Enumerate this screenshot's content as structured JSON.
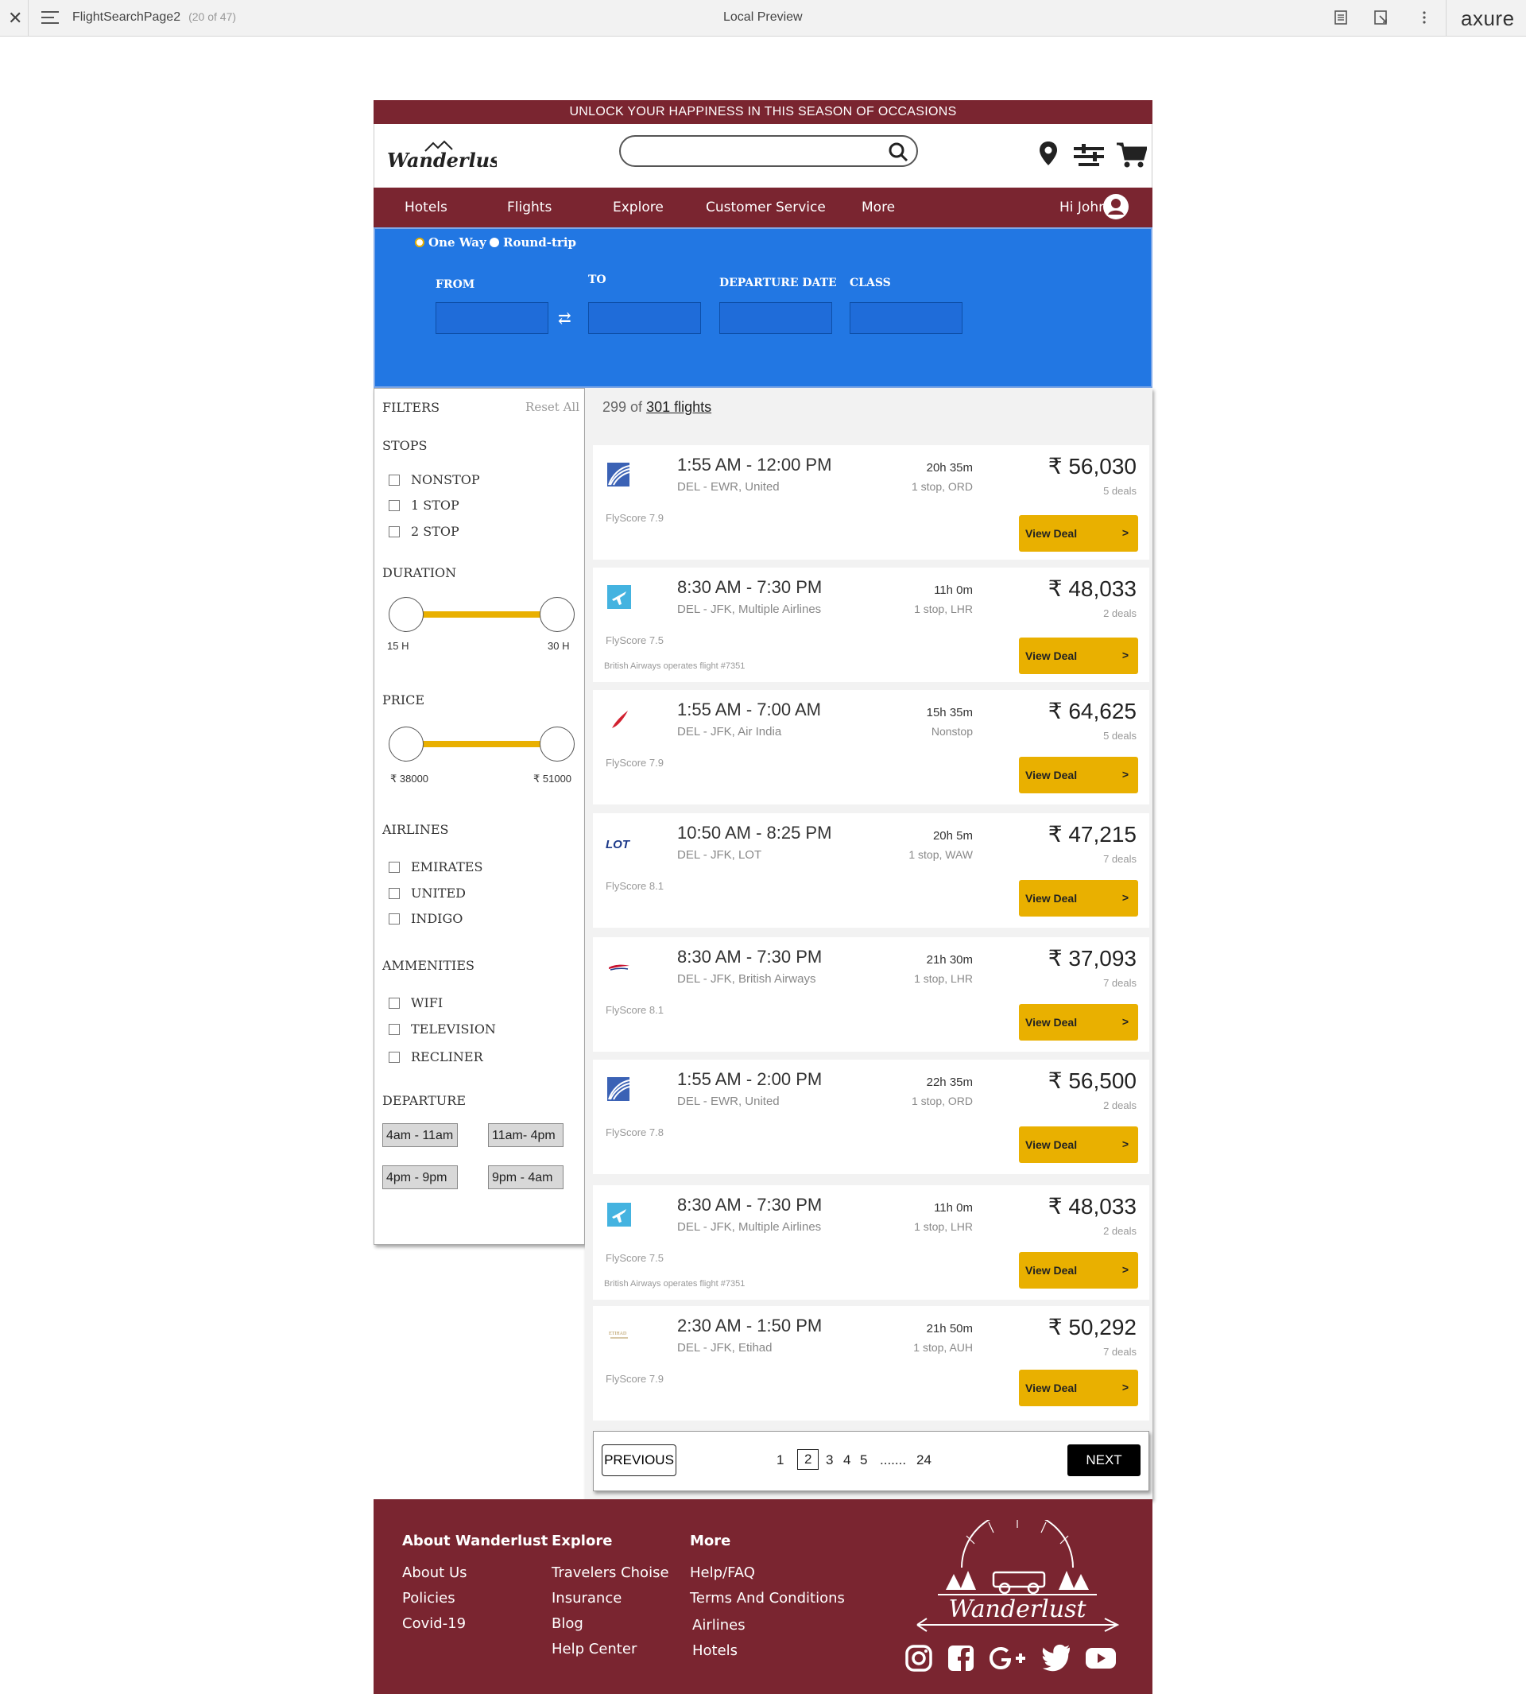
{
  "viewer": {
    "page_title": "FlightSearchPage2",
    "page_count": "(20 of 47)",
    "center_title": "Local Preview",
    "brand": "axure"
  },
  "promo": "UNLOCK YOUR HAPPINESS IN THIS SEASON OF OCCASIONS",
  "header": {
    "logo": "Wanderlust",
    "search_value": ""
  },
  "nav": {
    "hotels": "Hotels",
    "flights": "Flights",
    "explore": "Explore",
    "customer_service": "Customer Service",
    "more": "More",
    "greeting": "Hi John"
  },
  "form": {
    "one_way": "One Way",
    "round_trip": "Round-trip",
    "from": "FROM",
    "to": "TO",
    "departure_date": "DEPARTURE DATE",
    "class": "CLASS"
  },
  "filters": {
    "title": "FILTERS",
    "reset": "Reset All",
    "stops_title": "STOPS",
    "stops": [
      "NONSTOP",
      "1 STOP",
      "2 STOP"
    ],
    "duration_title": "DURATION",
    "duration_min": "15 H",
    "duration_max": "30 H",
    "price_title": "PRICE",
    "price_min": "₹ 38000",
    "price_max": "₹ 51000",
    "airlines_title": "AIRLINES",
    "airlines": [
      "EMIRATES",
      "UNITED",
      "INDIGO"
    ],
    "amenities_title": "AMMENITIES",
    "amenities": [
      "WIFI",
      "TELEVISION",
      "RECLINER"
    ],
    "departure_title": "DEPARTURE",
    "departure": [
      "4am - 11am",
      "11am- 4pm",
      "4pm - 9pm",
      "9pm - 4am"
    ]
  },
  "results": {
    "count_prefix": "299 of",
    "count_link": "301 flights",
    "view_deal": "View Deal",
    "arrow": ">",
    "flights": [
      {
        "time": "1:55 AM - 12:00 PM",
        "route": "DEL - EWR, United",
        "duration": "20h 35m",
        "stops": "1 stop, ORD",
        "price": "₹ 56,030",
        "deals": "5 deals",
        "flyscore": "FlyScore 7.9",
        "note": "",
        "airline_icon": "united-icon"
      },
      {
        "time": "8:30 AM - 7:30 PM",
        "route": "DEL - JFK, Multiple Airlines",
        "duration": "11h 0m",
        "stops": "1 stop, LHR",
        "price": "₹ 48,033",
        "deals": "2 deals",
        "flyscore": "FlyScore 7.5",
        "note": "British Airways operates flight #7351",
        "airline_icon": "multiple-airlines-icon"
      },
      {
        "time": "1:55 AM - 7:00 AM",
        "route": "DEL - JFK, Air India",
        "duration": "15h 35m",
        "stops": "Nonstop",
        "price": "₹ 64,625",
        "deals": "5 deals",
        "flyscore": "FlyScore 7.9",
        "note": "",
        "airline_icon": "air-india-icon"
      },
      {
        "time": "10:50 AM - 8:25 PM",
        "route": "DEL - JFK, LOT",
        "duration": "20h 5m",
        "stops": "1 stop, WAW",
        "price": "₹ 47,215",
        "deals": "7 deals",
        "flyscore": "FlyScore 8.1",
        "note": "",
        "airline_icon": "lot-icon"
      },
      {
        "time": "8:30 AM - 7:30 PM",
        "route": "DEL - JFK, British Airways",
        "duration": "21h 30m",
        "stops": "1 stop, LHR",
        "price": "₹ 37,093",
        "deals": "7 deals",
        "flyscore": "FlyScore 8.1",
        "note": "",
        "airline_icon": "british-airways-icon"
      },
      {
        "time": "1:55 AM - 2:00 PM",
        "route": "DEL - EWR, United",
        "duration": "22h 35m",
        "stops": "1 stop, ORD",
        "price": "₹ 56,500",
        "deals": "2 deals",
        "flyscore": "FlyScore 7.8",
        "note": "",
        "airline_icon": "united-icon"
      },
      {
        "time": "8:30 AM - 7:30 PM",
        "route": "DEL - JFK, Multiple Airlines",
        "duration": "11h 0m",
        "stops": "1 stop, LHR",
        "price": "₹ 48,033",
        "deals": "2 deals",
        "flyscore": "FlyScore 7.5",
        "note": "British Airways operates flight #7351",
        "airline_icon": "multiple-airlines-icon"
      },
      {
        "time": "2:30 AM - 1:50 PM",
        "route": "DEL - JFK, Etihad",
        "duration": "21h 50m",
        "stops": "1 stop, AUH",
        "price": "₹ 50,292",
        "deals": "7 deals",
        "flyscore": "FlyScore 7.9",
        "note": "",
        "airline_icon": "etihad-icon"
      }
    ]
  },
  "pagination": {
    "previous": "PREVIOUS",
    "pages": [
      "1",
      "2",
      "3",
      "4",
      "5",
      ".......",
      "24"
    ],
    "current": "2",
    "next": "NEXT"
  },
  "footer": {
    "col1_title": "About Wanderlust",
    "col1": [
      "About Us",
      "Policies",
      "Covid-19"
    ],
    "col2_title": "Explore",
    "col2": [
      "Travelers Choise",
      "Insurance",
      "Blog",
      "Help Center"
    ],
    "col3_title": "More",
    "col3": [
      "Help/FAQ",
      "Terms And Conditions",
      "Airlines",
      "Hotels"
    ],
    "brand": "Wanderlust",
    "social": [
      "instagram-icon",
      "facebook-icon",
      "google-plus-icon",
      "twitter-icon",
      "youtube-icon"
    ]
  },
  "colors": {
    "brand": "#7a2530",
    "accent": "#e9b000",
    "form_bg": "#2277e3"
  }
}
